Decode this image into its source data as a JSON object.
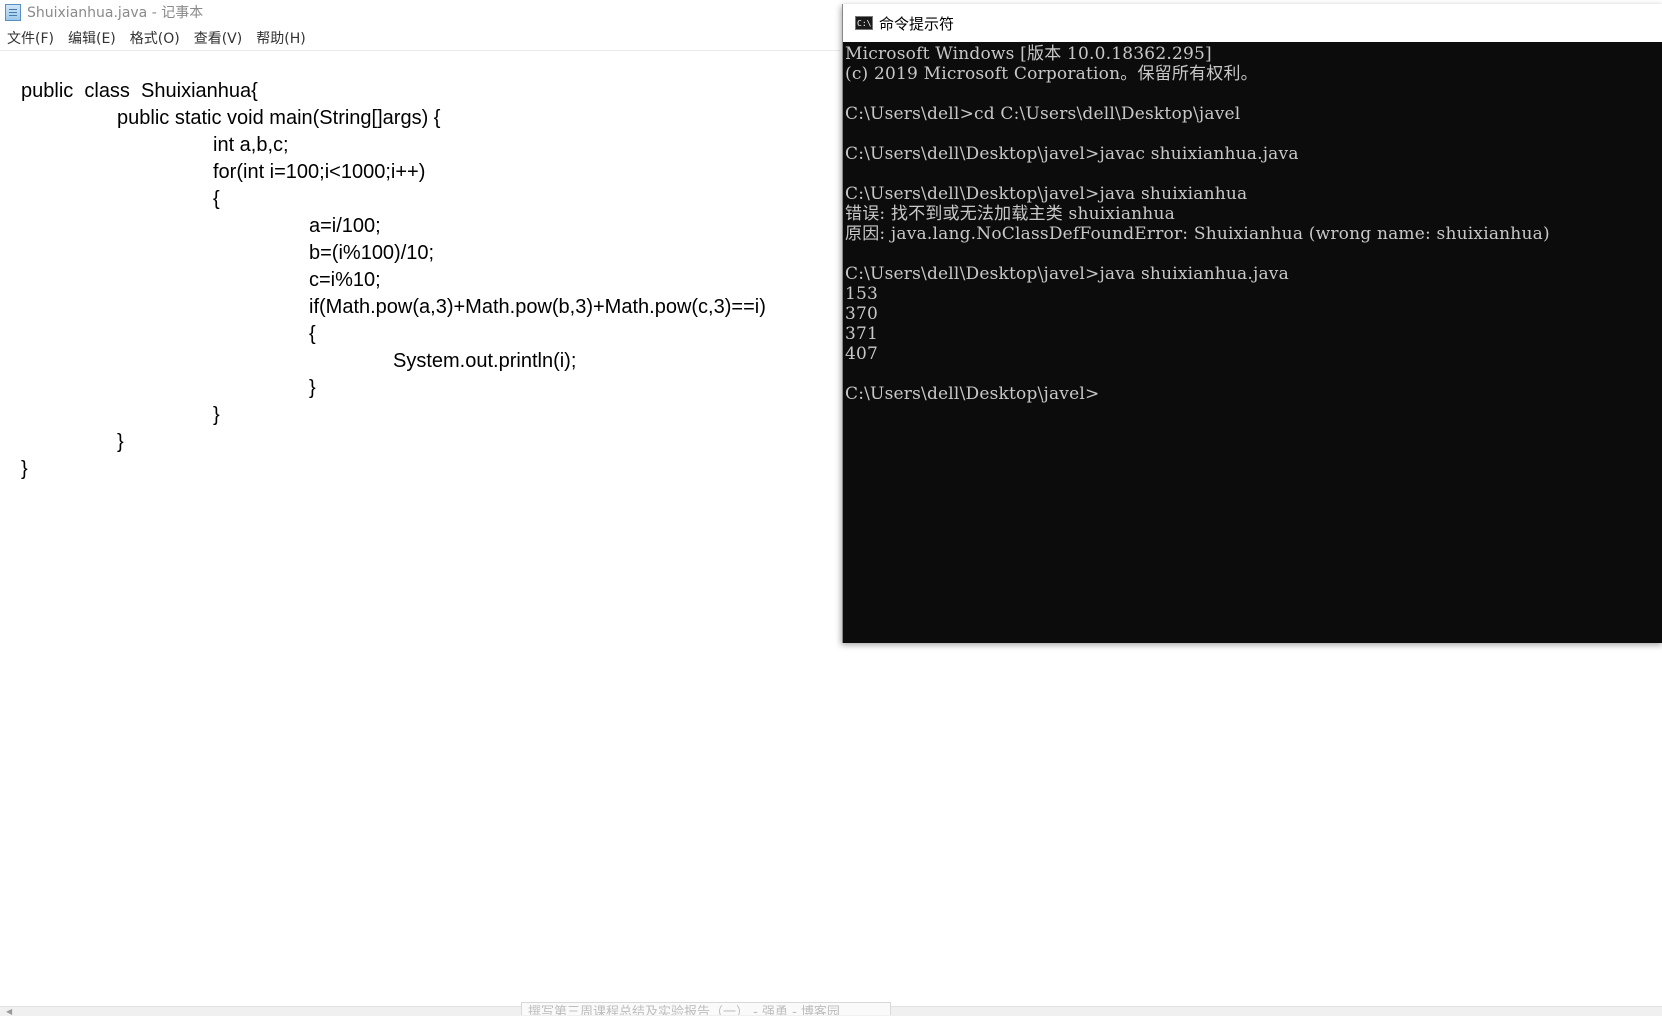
{
  "notepad": {
    "title": "Shuixianhua.java - 记事本",
    "menu": [
      "文件(F)",
      "编辑(E)",
      "格式(O)",
      "查看(V)",
      "帮助(H)"
    ],
    "code_lines": [
      {
        "text": "public  class  Shuixianhua{",
        "indent": 0
      },
      {
        "text": "public static void main(String[]args) {",
        "indent": 1
      },
      {
        "text": "int a,b,c;",
        "indent": 2
      },
      {
        "text": "for(int i=100;i<1000;i++)",
        "indent": 2
      },
      {
        "text": "{",
        "indent": 2
      },
      {
        "text": "a=i/100;",
        "indent": 3
      },
      {
        "text": "b=(i%100)/10;",
        "indent": 3
      },
      {
        "text": "c=i%10;",
        "indent": 3
      },
      {
        "text": "if(Math.pow(a,3)+Math.pow(b,3)+Math.pow(c,3)==i)",
        "indent": 3
      },
      {
        "text": "{",
        "indent": 3
      },
      {
        "text": "System.out.println(i);",
        "indent": 4
      },
      {
        "text": "}",
        "indent": 3
      },
      {
        "text": "}",
        "indent": 2
      },
      {
        "text": "}",
        "indent": 1
      },
      {
        "text": "}",
        "indent": 0
      }
    ]
  },
  "taskbar_tooltip": "撰写第三周课程总结及实验报告（一） - 强勇 - 博客园",
  "cmd": {
    "title": "命令提示符",
    "icon_label": "C:\\",
    "lines": [
      "Microsoft Windows [版本 10.0.18362.295]",
      "(c) 2019 Microsoft Corporation。保留所有权利。",
      "",
      "C:\\Users\\dell>cd C:\\Users\\dell\\Desktop\\javel",
      "",
      "C:\\Users\\dell\\Desktop\\javel>javac shuixianhua.java",
      "",
      "C:\\Users\\dell\\Desktop\\javel>java shuixianhua",
      "错误: 找不到或无法加载主类 shuixianhua",
      "原因: java.lang.NoClassDefFoundError: Shuixianhua (wrong name: shuixianhua)",
      "",
      "C:\\Users\\dell\\Desktop\\javel>java shuixianhua.java",
      "153",
      "370",
      "371",
      "407",
      "",
      "C:\\Users\\dell\\Desktop\\javel>"
    ]
  }
}
